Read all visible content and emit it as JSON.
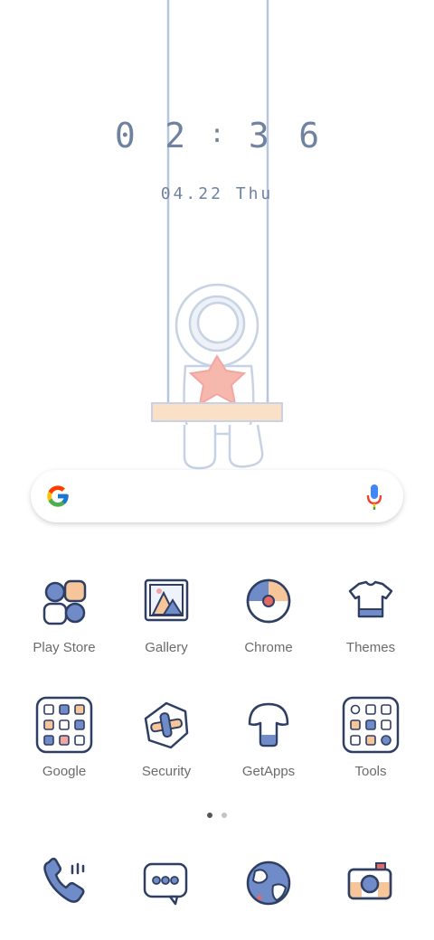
{
  "clock": {
    "digits": [
      "0",
      "2",
      ":",
      "3",
      "6"
    ]
  },
  "date": {
    "text": "04.22 Thu"
  },
  "search": {
    "google_icon": "google-g-icon",
    "mic_icon": "microphone-icon"
  },
  "apps_row1": [
    {
      "label": "Play Store",
      "icon": "play-store-icon"
    },
    {
      "label": "Gallery",
      "icon": "gallery-icon"
    },
    {
      "label": "Chrome",
      "icon": "chrome-icon"
    },
    {
      "label": "Themes",
      "icon": "themes-icon"
    }
  ],
  "apps_row2": [
    {
      "label": "Google",
      "icon": "google-folder-icon"
    },
    {
      "label": "Security",
      "icon": "security-icon"
    },
    {
      "label": "GetApps",
      "icon": "getapps-icon"
    },
    {
      "label": "Tools",
      "icon": "tools-folder-icon"
    }
  ],
  "page_indicator": {
    "count": 2,
    "active": 1
  },
  "dock": [
    {
      "icon": "phone-icon"
    },
    {
      "icon": "messages-icon"
    },
    {
      "icon": "browser-icon"
    },
    {
      "icon": "camera-icon"
    }
  ],
  "colors": {
    "navy": "#2f3f63",
    "blue": "#6f8bc8",
    "peach": "#f7c59a",
    "pink": "#f3a6a1",
    "text": "#6b6b6b",
    "clock": "#6f82a0"
  }
}
